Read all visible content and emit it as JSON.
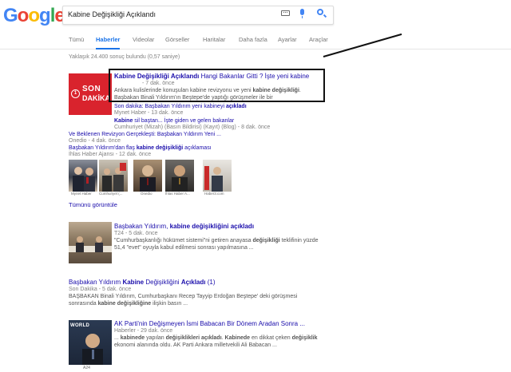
{
  "logo": [
    "G",
    "o",
    "o",
    "g",
    "l",
    "e"
  ],
  "search": {
    "value": "Kabine Değişikliği Açıklandı"
  },
  "tabs": [
    {
      "label": "Tümü",
      "active": false
    },
    {
      "label": "Haberler",
      "active": true
    },
    {
      "label": "Videolar",
      "active": false
    },
    {
      "label": "Görseller",
      "active": false
    },
    {
      "label": "Haritalar",
      "active": false
    },
    {
      "label": "Daha fazla",
      "active": false
    },
    {
      "label": "Ayarlar",
      "active": false
    },
    {
      "label": "Araçlar",
      "active": false
    }
  ],
  "result_stats": "Yaklaşık 24.400 sonuç bulundu (0,57 saniye)",
  "top_story": {
    "logo_text_1": "SON",
    "logo_text_2": "DAKİKA",
    "logo_badge": "1",
    "title_bold": "Kabine Değişikliği Açıklandı",
    "title_rest": " Hangi Bakanlar Gitti ? İşte yeni kabine",
    "meta": "- 7 dak. önce",
    "snippet_1_pre": "Ankara kulislerinde konuşulan kabine revizyonu ve yeni ",
    "snippet_1_bold": "kabine değişikliği",
    "snippet_1_post": ".",
    "snippet_2": "Başbakan Binali Yıldırım'ın Beştepe'de yaptığı görüşmeler ile bir",
    "sub1_title_pre": "Son dakika: Başbakan Yıldırım yeni kabineyi ",
    "sub1_title_bold": "açıkladı",
    "sub1_meta": "Mynet Haber - 13 dak. önce",
    "sub2_title_bold": "Kabine",
    "sub2_title_rest": " sil baştan... İşte giden ve gelen bakanlar",
    "sub2_meta": "Cumhuriyet (Mizah) (Basın Bildirisi) (Kayıt) (Blog) - 8 dak. önce",
    "sub3_title": "Ve Beklenen Revizyon Gerçekleşti: Başbakan Yıldırım Yeni ...",
    "sub3_meta": "Onedio - 4 dak. önce",
    "sub4_title_pre": "Başbakan Yıldırım'dan flaş ",
    "sub4_title_bold": "kabine değişikliği",
    "sub4_title_post": " açıklaması",
    "sub4_meta": "İhlas Haber Ajansı - 12 dak. önce",
    "thumbs": [
      {
        "caption": "Mynet Haber"
      },
      {
        "caption": "Cumhuriyet (..."
      },
      {
        "caption": "Onedio"
      },
      {
        "caption": "İhlas Haber A..."
      },
      {
        "caption": "Haber3.com"
      }
    ],
    "view_all": "Tümünü görüntüle"
  },
  "results": [
    {
      "title_pre": "Başbakan Yıldırım, ",
      "title_bold": "kabine değişikliğini açıkladı",
      "meta": "T24 - 5 dak. önce",
      "snippet_1_pre": "\"Cumhurbaşkanlığı hükümet sistemi\"ni getiren anayasa ",
      "snippet_1_bold": "değişikliği",
      "snippet_1_post": " teklifinin yüzde",
      "snippet_2": "51,4 \"evet\" oyuyla kabul edilmesi sonrası yapılmasına ..."
    },
    {
      "title_pre": "Başbakan Yıldırım ",
      "title_bold": "Kabine",
      "title_mid": " Değişikliğini ",
      "title_bold2": "Açıkladı",
      "title_post": " (1)",
      "meta": "Son Dakika - 5 dak. önce",
      "snippet_1": "BAŞBAKAN Binali Yıldırım, Cumhurbaşkanı Recep Tayyip Erdoğan Beştepe' deki görüşmesi",
      "snippet_2_pre": "sonrasında ",
      "snippet_2_bold": "kabine değişikliğine",
      "snippet_2_post": " ilişkin basın ..."
    },
    {
      "title": "AK Parti'nin Değişmeyen İsmi Babacan Bir Dönem Aradan Sonra ...",
      "meta": "Haberler - 29 dak. önce",
      "snippet_1_pre": "... ",
      "snippet_1_bold": "kabinede",
      "snippet_1_mid": " yapılan ",
      "snippet_1_bold2": "değişiklikleri açıkladı",
      "snippet_1_mid2": ". ",
      "snippet_1_bold3": "Kabinede",
      "snippet_1_mid3": " en dikkat çeken ",
      "snippet_1_bold4": "değişiklik",
      "snippet_2": "ekonomi alanında oldu. AK Parti Ankara milletvekili Ali Babacan ...",
      "image_caption": "A24",
      "image_text": "WORLD"
    }
  ],
  "colors": {
    "accent": "#1a73e8",
    "link": "#1a0dab",
    "meta": "#808080",
    "son_dakika_red": "#d9232d"
  }
}
